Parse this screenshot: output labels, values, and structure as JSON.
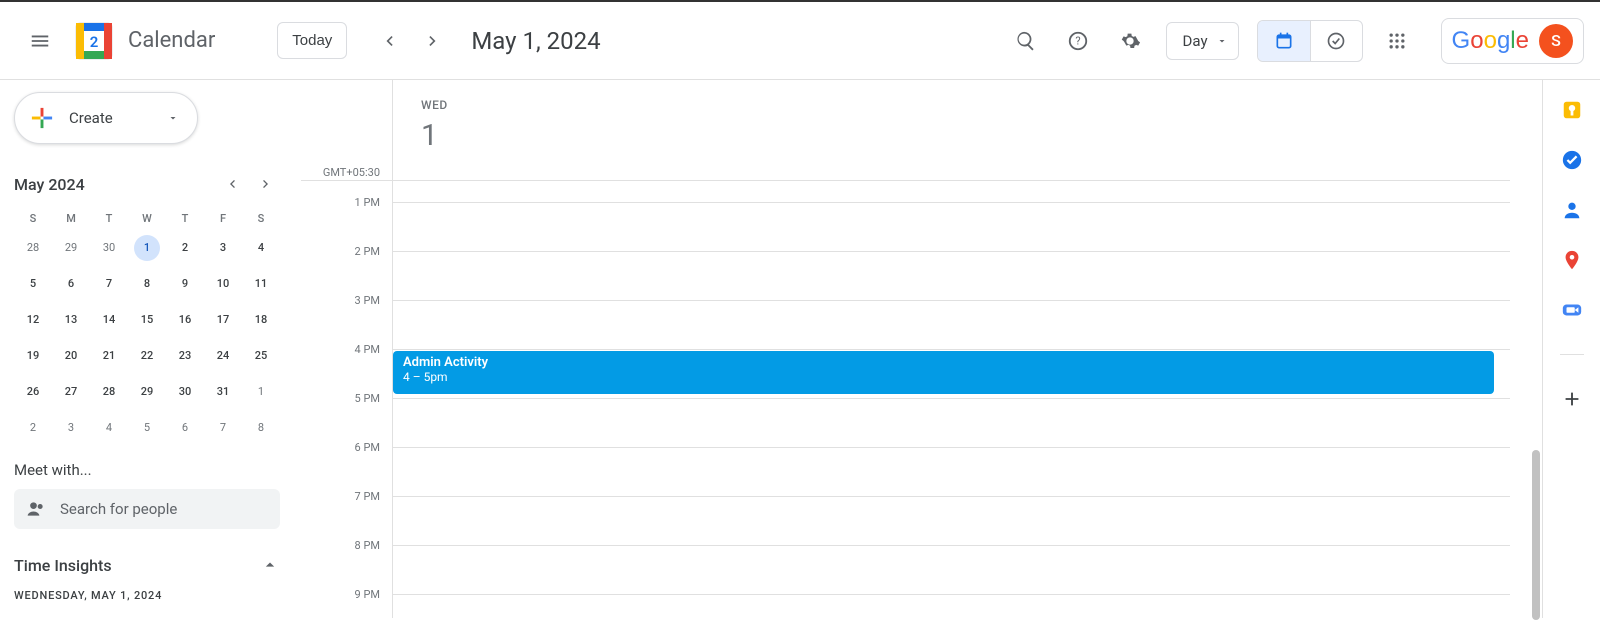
{
  "header": {
    "app_title": "Calendar",
    "logo_day": "2",
    "today_label": "Today",
    "date_title": "May 1, 2024",
    "view_label": "Day",
    "avatar_initial": "S"
  },
  "sidebar": {
    "create_label": "Create",
    "mini_cal": {
      "title": "May 2024",
      "dow": [
        "S",
        "M",
        "T",
        "W",
        "T",
        "F",
        "S"
      ],
      "weeks": [
        [
          {
            "d": "28",
            "muted": true
          },
          {
            "d": "29",
            "muted": true
          },
          {
            "d": "30",
            "muted": true
          },
          {
            "d": "1",
            "selected": true
          },
          {
            "d": "2"
          },
          {
            "d": "3"
          },
          {
            "d": "4"
          }
        ],
        [
          {
            "d": "5"
          },
          {
            "d": "6"
          },
          {
            "d": "7"
          },
          {
            "d": "8"
          },
          {
            "d": "9"
          },
          {
            "d": "10"
          },
          {
            "d": "11"
          }
        ],
        [
          {
            "d": "12"
          },
          {
            "d": "13"
          },
          {
            "d": "14"
          },
          {
            "d": "15"
          },
          {
            "d": "16"
          },
          {
            "d": "17"
          },
          {
            "d": "18"
          }
        ],
        [
          {
            "d": "19"
          },
          {
            "d": "20"
          },
          {
            "d": "21"
          },
          {
            "d": "22"
          },
          {
            "d": "23"
          },
          {
            "d": "24"
          },
          {
            "d": "25"
          }
        ],
        [
          {
            "d": "26"
          },
          {
            "d": "27"
          },
          {
            "d": "28"
          },
          {
            "d": "29"
          },
          {
            "d": "30"
          },
          {
            "d": "31"
          },
          {
            "d": "1",
            "muted": true
          }
        ],
        [
          {
            "d": "2",
            "muted": true
          },
          {
            "d": "3",
            "muted": true
          },
          {
            "d": "4",
            "muted": true
          },
          {
            "d": "5",
            "muted": true
          },
          {
            "d": "6",
            "muted": true
          },
          {
            "d": "7",
            "muted": true
          },
          {
            "d": "8",
            "muted": true
          }
        ]
      ]
    },
    "meet_with_label": "Meet with...",
    "search_people_placeholder": "Search for people",
    "time_insights_label": "Time Insights",
    "time_insights_sub": "WEDNESDAY, MAY 1, 2024"
  },
  "grid": {
    "timezone": "GMT+05:30",
    "day_of_week": "WED",
    "day_number": "1",
    "hours": [
      "1 PM",
      "2 PM",
      "3 PM",
      "4 PM",
      "5 PM",
      "6 PM",
      "7 PM",
      "8 PM",
      "9 PM"
    ],
    "event": {
      "title": "Admin Activity",
      "time": "4 – 5pm"
    }
  },
  "colors": {
    "event_bg": "#039be5",
    "selected_date_bg": "#d2e3fc",
    "avatar_bg": "#f4511e"
  }
}
